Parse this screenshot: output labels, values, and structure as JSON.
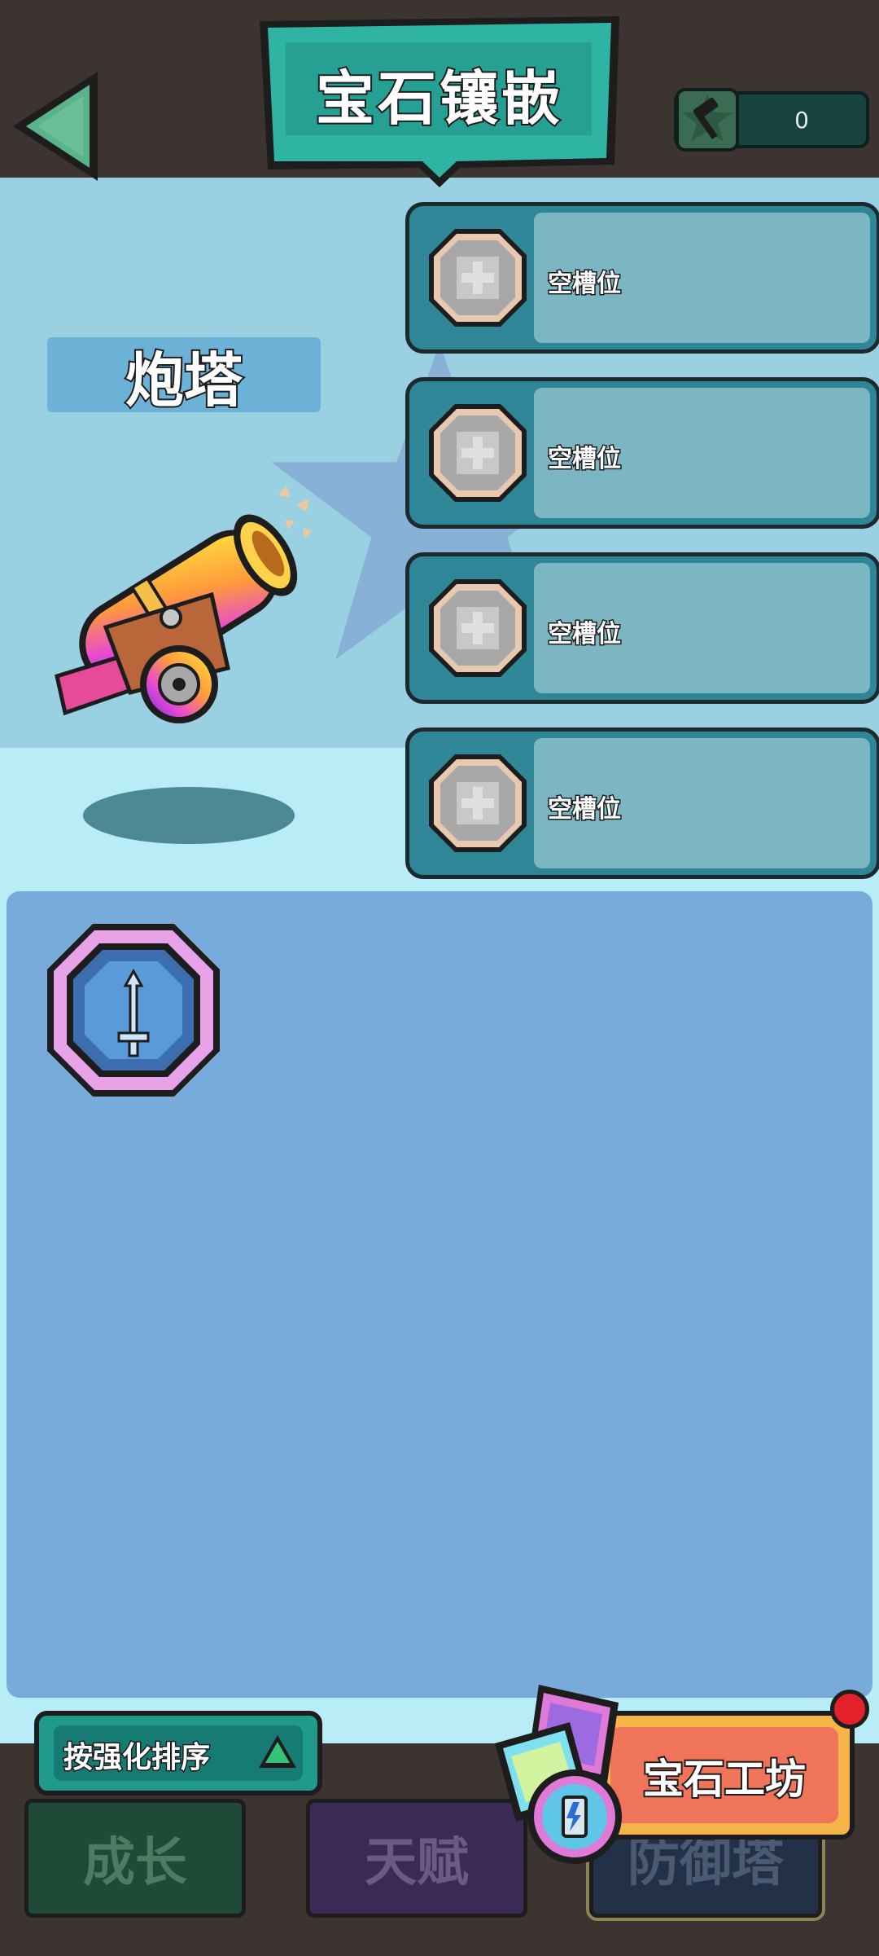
{
  "header": {
    "title": "宝石镶嵌",
    "hammer_count": "0"
  },
  "tower": {
    "name": "炮塔"
  },
  "slots": [
    {
      "label": "空槽位"
    },
    {
      "label": "空槽位"
    },
    {
      "label": "空槽位"
    },
    {
      "label": "空槽位"
    }
  ],
  "inventory": {
    "sort_label": "按强化排序"
  },
  "workshop": {
    "label": "宝石工坊"
  },
  "tabs": [
    {
      "label": "成长"
    },
    {
      "label": "天赋"
    },
    {
      "label": "防御塔"
    }
  ],
  "colors": {
    "background_top": "#3b3430",
    "tower_area": "#9ad1e2",
    "inventory_bg": "#79abda",
    "slot_frame": "#2e8696",
    "accent_teal": "#1f9a8d",
    "workshop_orange": "#f0745a",
    "notification_red": "#e4212b"
  }
}
